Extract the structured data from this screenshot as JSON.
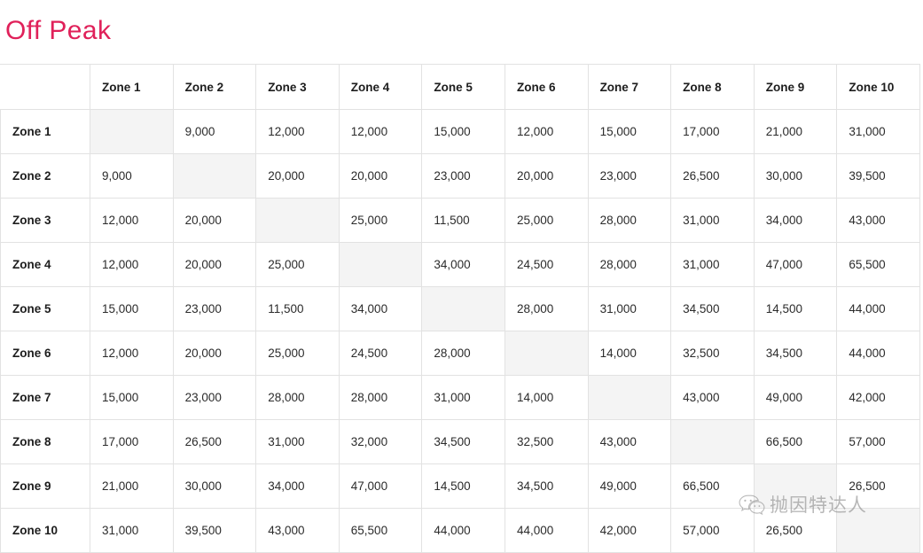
{
  "title": "Off Peak",
  "colors": {
    "title": "#E0215A",
    "grid_line": "#E2E2E2",
    "diagonal_cell": "#F4F4F4",
    "text": "#2B2B2B",
    "watermark": "#8D8D8D"
  },
  "table": {
    "corner_label": "",
    "column_headers": [
      "Zone 1",
      "Zone 2",
      "Zone 3",
      "Zone 4",
      "Zone 5",
      "Zone 6",
      "Zone 7",
      "Zone 8",
      "Zone 9",
      "Zone 10"
    ],
    "row_headers": [
      "Zone 1",
      "Zone 2",
      "Zone 3",
      "Zone 4",
      "Zone 5",
      "Zone 6",
      "Zone 7",
      "Zone 8",
      "Zone 9",
      "Zone 10"
    ],
    "rows": [
      [
        "",
        "9,000",
        "12,000",
        "12,000",
        "15,000",
        "12,000",
        "15,000",
        "17,000",
        "21,000",
        "31,000"
      ],
      [
        "9,000",
        "",
        "20,000",
        "20,000",
        "23,000",
        "20,000",
        "23,000",
        "26,500",
        "30,000",
        "39,500"
      ],
      [
        "12,000",
        "20,000",
        "",
        "25,000",
        "11,500",
        "25,000",
        "28,000",
        "31,000",
        "34,000",
        "43,000"
      ],
      [
        "12,000",
        "20,000",
        "25,000",
        "",
        "34,000",
        "24,500",
        "28,000",
        "31,000",
        "47,000",
        "65,500"
      ],
      [
        "15,000",
        "23,000",
        "11,500",
        "34,000",
        "",
        "28,000",
        "31,000",
        "34,500",
        "14,500",
        "44,000"
      ],
      [
        "12,000",
        "20,000",
        "25,000",
        "24,500",
        "28,000",
        "",
        "14,000",
        "32,500",
        "34,500",
        "44,000"
      ],
      [
        "15,000",
        "23,000",
        "28,000",
        "28,000",
        "31,000",
        "14,000",
        "",
        "43,000",
        "49,000",
        "42,000"
      ],
      [
        "17,000",
        "26,500",
        "31,000",
        "32,000",
        "34,500",
        "32,500",
        "43,000",
        "",
        "66,500",
        "57,000"
      ],
      [
        "21,000",
        "30,000",
        "34,000",
        "47,000",
        "14,500",
        "34,500",
        "49,000",
        "66,500",
        "",
        "26,500"
      ],
      [
        "31,000",
        "39,500",
        "43,000",
        "65,500",
        "44,000",
        "44,000",
        "42,000",
        "57,000",
        "26,500",
        ""
      ]
    ]
  },
  "chart_data": {
    "type": "table",
    "title": "Off Peak",
    "categories": [
      "Zone 1",
      "Zone 2",
      "Zone 3",
      "Zone 4",
      "Zone 5",
      "Zone 6",
      "Zone 7",
      "Zone 8",
      "Zone 9",
      "Zone 10"
    ],
    "row_labels": [
      "Zone 1",
      "Zone 2",
      "Zone 3",
      "Zone 4",
      "Zone 5",
      "Zone 6",
      "Zone 7",
      "Zone 8",
      "Zone 9",
      "Zone 10"
    ],
    "values": [
      [
        null,
        9000,
        12000,
        12000,
        15000,
        12000,
        15000,
        17000,
        21000,
        31000
      ],
      [
        9000,
        null,
        20000,
        20000,
        23000,
        20000,
        23000,
        26500,
        30000,
        39500
      ],
      [
        12000,
        20000,
        null,
        25000,
        11500,
        25000,
        28000,
        31000,
        34000,
        43000
      ],
      [
        12000,
        20000,
        25000,
        null,
        34000,
        24500,
        28000,
        31000,
        47000,
        65500
      ],
      [
        15000,
        23000,
        11500,
        34000,
        null,
        28000,
        31000,
        34500,
        14500,
        44000
      ],
      [
        12000,
        20000,
        25000,
        24500,
        28000,
        null,
        14000,
        32500,
        34500,
        44000
      ],
      [
        15000,
        23000,
        28000,
        28000,
        31000,
        14000,
        null,
        43000,
        49000,
        42000
      ],
      [
        17000,
        26500,
        31000,
        32000,
        34500,
        32500,
        43000,
        null,
        66500,
        57000
      ],
      [
        21000,
        30000,
        34000,
        47000,
        14500,
        34500,
        49000,
        66500,
        null,
        26500
      ],
      [
        31000,
        39500,
        43000,
        65500,
        44000,
        44000,
        42000,
        57000,
        26500,
        null
      ]
    ],
    "xlabel": "",
    "ylabel": "",
    "grid": true,
    "legend": "none"
  },
  "watermark": {
    "icon": "wechat-icon",
    "text": "抛因特达人"
  }
}
